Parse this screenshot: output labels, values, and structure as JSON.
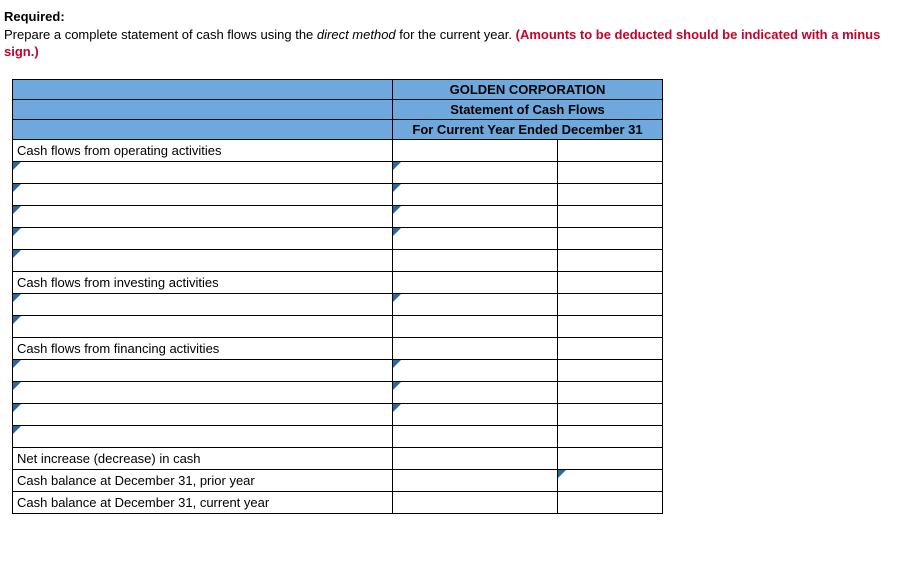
{
  "instructions": {
    "required_label": "Required:",
    "line1_a": "Prepare a complete statement of cash flows using the ",
    "line1_b_italic": "direct method",
    "line1_c": " for the current year. ",
    "red_part": "(Amounts to be deducted should be indicated with a minus sign.)"
  },
  "header": {
    "company": "GOLDEN CORPORATION",
    "title": "Statement of Cash Flows",
    "period": "For Current Year Ended December 31"
  },
  "sections": {
    "operating": "Cash flows from operating activities",
    "investing": "Cash flows from investing activities",
    "financing": "Cash flows from financing activities"
  },
  "footer": {
    "net_change": "Net increase (decrease) in cash",
    "prior_bal": "Cash balance at December 31, prior year",
    "curr_bal": "Cash balance at December 31, current year"
  }
}
